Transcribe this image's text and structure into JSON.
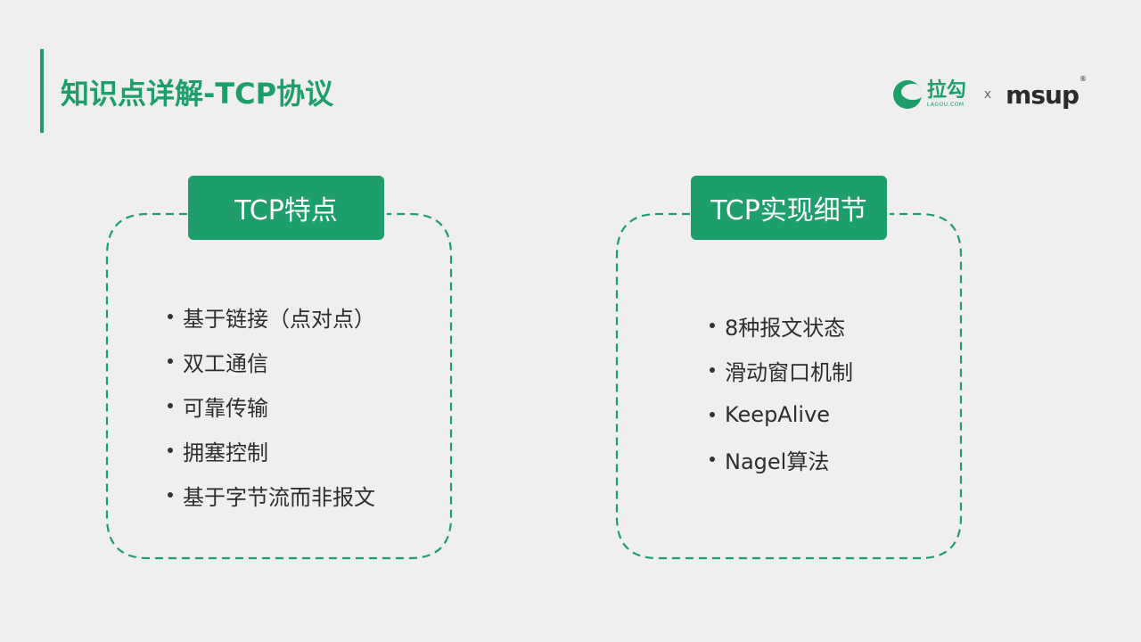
{
  "header": {
    "title": "知识点详解-TCP协议"
  },
  "brand": {
    "lagou_cn": "拉勾",
    "lagou_en": "LAGOU.COM",
    "separator": "x",
    "msup": "msup",
    "registered_mark": "®"
  },
  "left_card": {
    "heading": "TCP特点",
    "items": [
      "基于链接（点对点）",
      "双工通信",
      "可靠传输",
      "拥塞控制",
      "基于字节流而非报文"
    ]
  },
  "right_card": {
    "heading": "TCP实现细节",
    "items": [
      "8种报文状态",
      "滑动窗口机制",
      "KeepAlive",
      "Nagel算法"
    ]
  },
  "colors": {
    "accent": "#1e9e6b",
    "background": "#efefef",
    "text": "#2e2e2e"
  }
}
